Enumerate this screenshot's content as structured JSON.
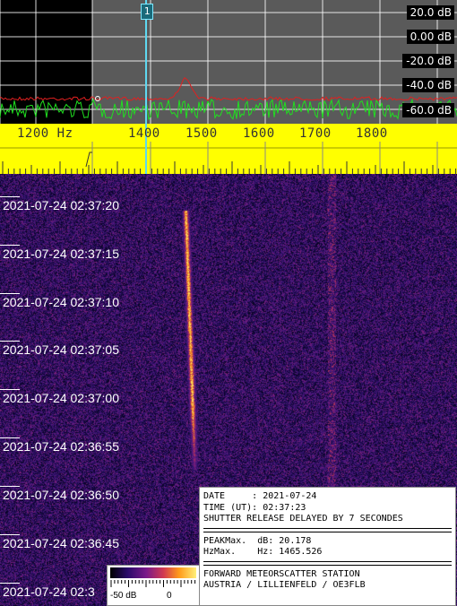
{
  "spectrum": {
    "db_labels": [
      "20.0 dB",
      "0.00 dB",
      "-20.0 dB",
      "-40.0 dB",
      "-60.0 dB"
    ],
    "marker_label": "1",
    "colors": {
      "background": "#000000",
      "shade": "#5a5a5a",
      "grid": "#ffffff",
      "trace": "#20e020",
      "peak_hold": "#e02020",
      "marker": "#5fd8f0"
    }
  },
  "ruler": {
    "frequency_labels": [
      "1200 Hz",
      "1400",
      "1500",
      "1600",
      "1700",
      "1800"
    ],
    "color": "#ffff00"
  },
  "waterfall": {
    "time_labels": [
      "2021-07-24 02:37:20",
      "2021-07-24 02:37:15",
      "2021-07-24 02:37:10",
      "2021-07-24 02:37:05",
      "2021-07-24 02:37:00",
      "2021-07-24 02:36:55",
      "2021-07-24 02:36:50",
      "2021-07-24 02:36:45",
      "2021-07-24 02:3"
    ]
  },
  "info": {
    "date_line": "DATE     : 2021-07-24",
    "time_line": "TIME (UT): 02:37:23",
    "shutter_line": "SHUTTER RELEASE DELAYED BY 7 SECONDES",
    "peak_db_line": "PEAKMax.  dB: 20.178",
    "peak_hz_line": "HzMax.    Hz: 1465.526",
    "station_line": "FORWARD METEORSCATTER STATION",
    "location_line": "AUSTRIA / LILLIENFELD / OE3FLB"
  },
  "legend": {
    "min_label": "-50 dB",
    "max_label": "0"
  }
}
